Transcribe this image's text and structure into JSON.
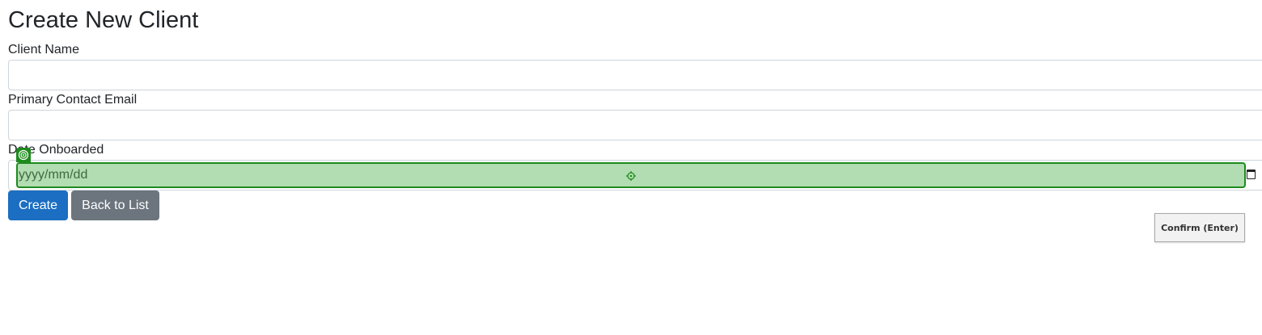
{
  "page": {
    "title": "Create New Client"
  },
  "form": {
    "client_name": {
      "label": "Client Name",
      "value": ""
    },
    "primary_contact_email": {
      "label": "Primary Contact Email",
      "value": ""
    },
    "date_onboarded": {
      "label": "Date Onboarded",
      "placeholder": "yyyy/mm/dd"
    }
  },
  "actions": {
    "create_label": "Create",
    "back_label": "Back to List"
  },
  "overlay": {
    "confirm_label": "Confirm (Enter)",
    "highlight_color": "#b2ddb2",
    "highlight_border_color": "#1e8a1e"
  },
  "colors": {
    "primary": "#1b6ec2",
    "secondary": "#6c757d"
  },
  "icons": {
    "calendar": "calendar-icon",
    "target": "target-icon",
    "marker": "marker-badge-icon"
  }
}
